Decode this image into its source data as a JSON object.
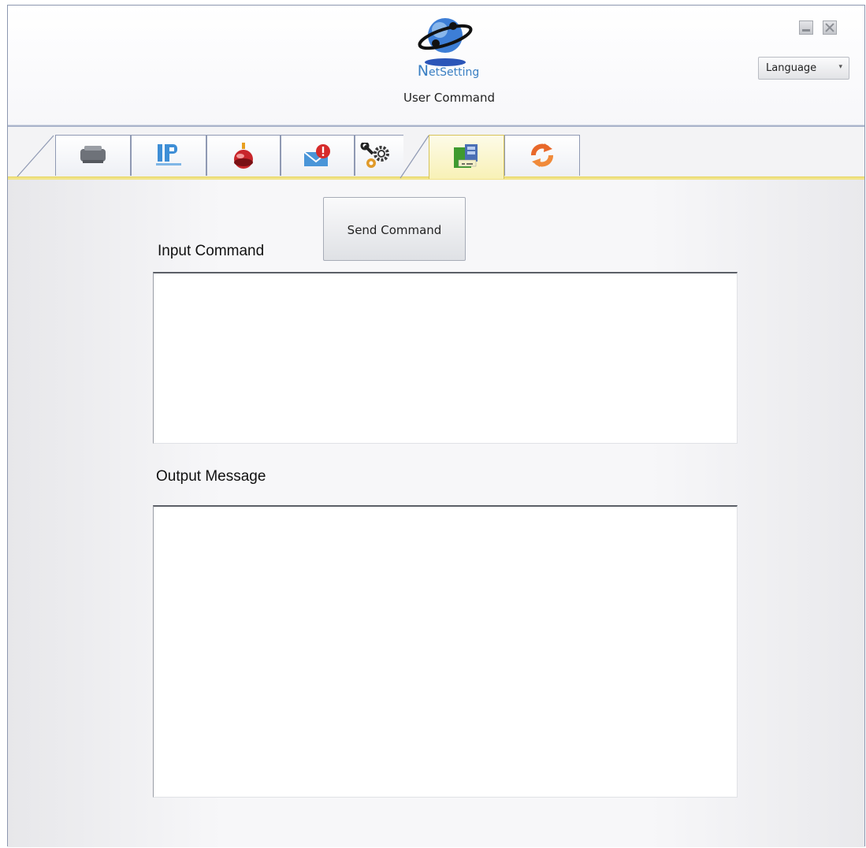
{
  "header": {
    "brand_first": "N",
    "brand_rest": "etSetting",
    "subtitle": "User Command",
    "language_label": "Language",
    "language_arrow": "▾"
  },
  "tabs": [
    {
      "icon": "printer-icon",
      "active": false
    },
    {
      "icon": "ip-network-icon",
      "active": false
    },
    {
      "icon": "alert-siren-icon",
      "active": false
    },
    {
      "icon": "mail-alert-icon",
      "active": false
    },
    {
      "icon": "gears-icon",
      "active": false
    },
    {
      "icon": "user-command-key-icon",
      "active": true
    },
    {
      "icon": "refresh-icon",
      "active": false
    }
  ],
  "main": {
    "send_button_label": "Send Command",
    "input_label": "Input Command",
    "input_value": "",
    "output_label": "Output Message",
    "output_value": ""
  },
  "colors": {
    "brand": "#3a7fc3",
    "active_tab": "#f8f1b6",
    "tab_underline": "#f1e48a"
  }
}
